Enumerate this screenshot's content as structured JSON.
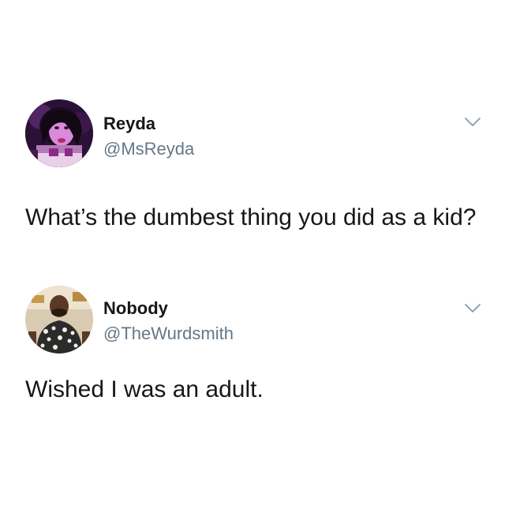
{
  "tweets": [
    {
      "display_name": "Reyda",
      "handle": "@MsReyda",
      "text": "What’s the dumbest thing you did as a kid?",
      "avatar_icon": "profile-photo-reyda",
      "menu_icon": "chevron-down-icon"
    },
    {
      "display_name": "Nobody",
      "handle": "@TheWurdsmith",
      "text": "Wished I was an adult.",
      "avatar_icon": "profile-photo-thewurdsmith",
      "menu_icon": "chevron-down-icon"
    }
  ],
  "colors": {
    "background": "#ffffff",
    "text_primary": "#14171a",
    "text_secondary": "#657786",
    "chevron": "#8899a6"
  }
}
